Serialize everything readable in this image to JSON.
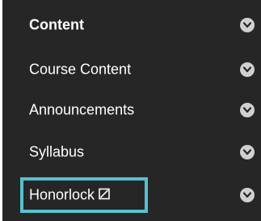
{
  "menu": {
    "items": [
      {
        "label": "Content",
        "icon": "chevron-down-icon"
      },
      {
        "label": "Course Content",
        "icon": "chevron-down-icon"
      },
      {
        "label": "Announcements",
        "icon": "chevron-down-icon"
      },
      {
        "label": "Syllabus",
        "icon": "chevron-down-icon"
      },
      {
        "label": "Honorlock",
        "icon": "chevron-down-icon",
        "badge_icon": "hidden-from-students-icon"
      }
    ]
  },
  "colors": {
    "menu_background": "#262626",
    "text": "#ffffff",
    "chevron_circle": "#d0d0d0",
    "highlight": "#56c1d1"
  }
}
